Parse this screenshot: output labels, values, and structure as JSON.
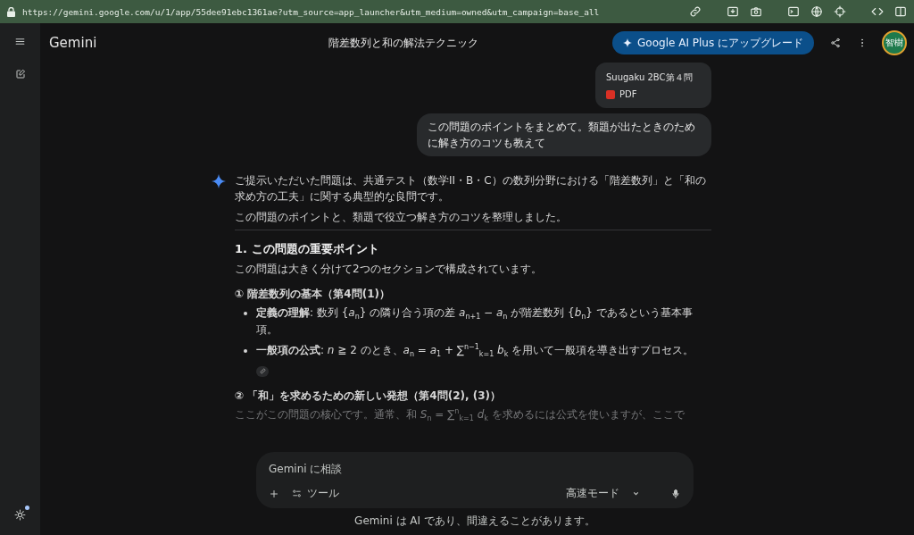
{
  "address_bar": {
    "url": "https://gemini.google.com/u/1/app/55dee91ebc1361ae?utm_source=app_launcher&utm_medium=owned&utm_campaign=base_all"
  },
  "header": {
    "app_name": "Gemini",
    "chat_title": "階差数列と和の解法テクニック",
    "upgrade_button": "Google AI Plus にアップグレード",
    "avatar": "智樹"
  },
  "attachment": {
    "name": "Suugaku 2BC第４問",
    "type": "PDF"
  },
  "user_message": "この問題のポイントをまとめて。類題が出たときのために解き方のコツも教えて",
  "response": {
    "intro": [
      "ご提示いただいた問題は、共通テスト（数学II・B・C）の数列分野における「階差数列」と「和の求め方の工夫」に関する典型的な良問です。",
      "この問題のポイントと、類題で役立つ解き方のコツを整理しました。"
    ],
    "heading": "1. この問題の重要ポイント",
    "lead": "この問題は大きく分けて2つのセクションで構成されています。",
    "sections": [
      {
        "title": "① 階差数列の基本（第4問(1)）",
        "bullets": [
          "**定義の理解**: 数列 {*a*$_{n}$} の隣り合う項の差 *a*$_{n+1}$ − *a*$_{n}$ が階差数列 {*b*$_{n}$} であるという基本事項。",
          "**一般項の公式**: *n* ≧ 2 のとき、*a*$_{n}$ = *a*$_{1}$ + ∑$^{n−1}$$_{k=1}$ *b*$_{k}$ を用いて一般項を導き出すプロセス。"
        ]
      },
      {
        "title": "② 「和」を求めるための新しい発想（第4問(2), (3)）"
      }
    ],
    "faded_line": "ここがこの問題の核心です。通常、和 *S*$_{n}$ = ∑$^{n}$$_{k=1}$ *d*$_{k}$ を求めるには公式を使いますが、ここで"
  },
  "composer": {
    "placeholder": "Gemini に相談",
    "tools_button": "ツール",
    "mode_button": "高速モード"
  },
  "disclaimer": "Gemini は AI であり、間違えることがあります。"
}
